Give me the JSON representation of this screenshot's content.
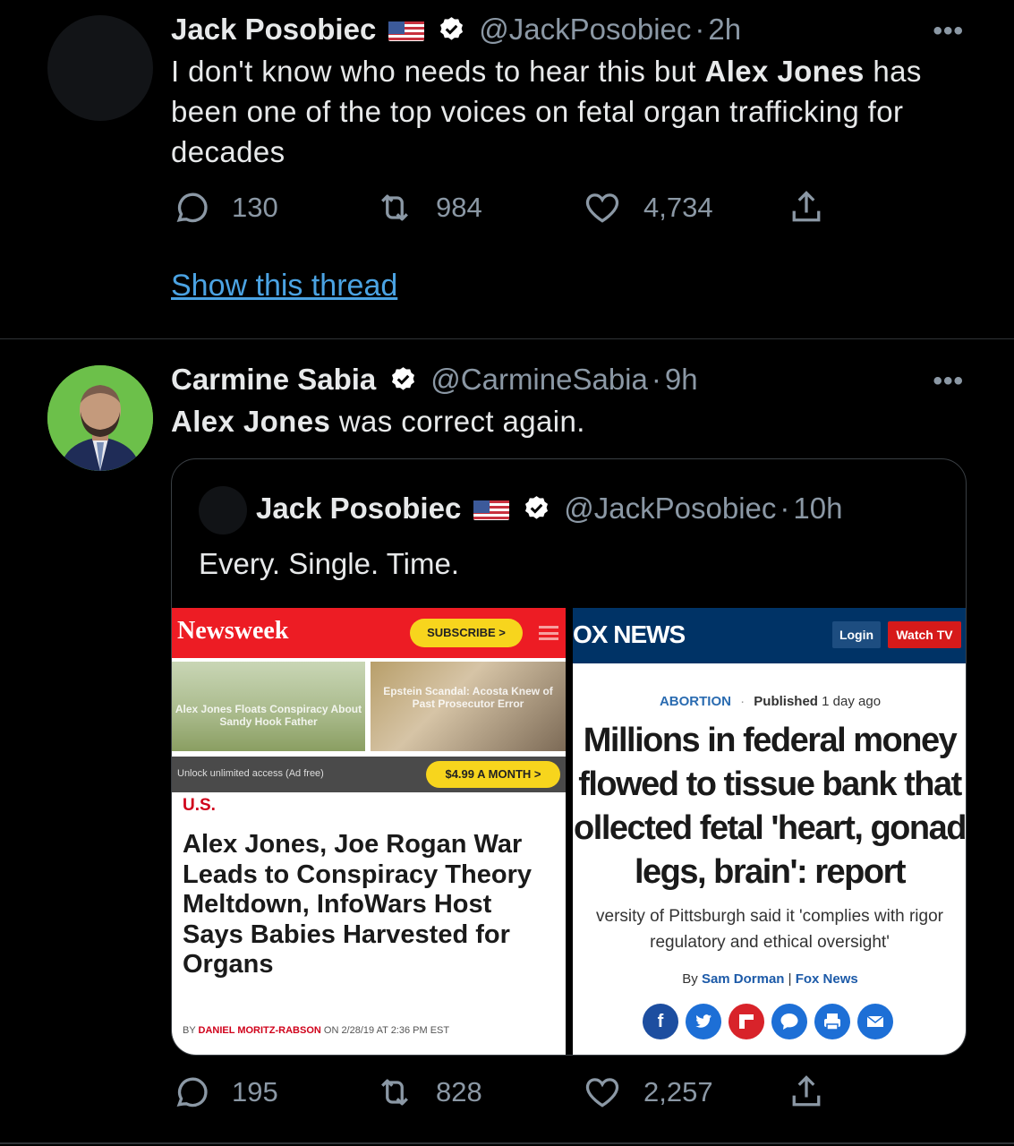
{
  "tweets": [
    {
      "name": "Jack Posobiec",
      "handle": "@JackPosobiec",
      "time_sep": "·",
      "time": "2h",
      "more": "•••",
      "text_pre": "I don't know who needs to hear this but ",
      "text_bold": "Alex Jones",
      "text_post": " has been one of the top voices on fetal organ trafficking for decades",
      "replies": "130",
      "retweets": "984",
      "likes": "4,734",
      "thread_link": "Show this thread"
    },
    {
      "name": "Carmine Sabia",
      "handle": "@CarmineSabia",
      "time_sep": "·",
      "time": "9h",
      "more": "•••",
      "text_bold": "Alex Jones",
      "text_post": " was correct again.",
      "replies": "195",
      "retweets": "828",
      "likes": "2,257",
      "quote": {
        "name": "Jack Posobiec",
        "handle": "@JackPosobiec",
        "time_sep": "·",
        "time": "10h",
        "text": "Every. Single. Time.",
        "newsweek": {
          "logo": "Newsweek",
          "subscribe": "SUBSCRIBE >",
          "thumb1_caption": "Alex Jones Floats Conspiracy About Sandy Hook Father",
          "thumb2_caption": "Epstein Scandal: Acosta Knew of Past Prosecutor Error",
          "unlock": "Unlock unlimited access (Ad free)",
          "price": "$4.99 A MONTH >",
          "section": "U.S.",
          "headline": "Alex Jones, Joe Rogan War Leads to Conspiracy Theory Meltdown, InfoWars Host Says Babies Harvested for Organs",
          "byline_pre": "BY ",
          "byline_author": "DANIEL MORITZ-RABSON",
          "byline_post": " ON 2/28/19 AT 2:36 PM EST"
        },
        "fox": {
          "logo": "OX NEWS",
          "login": "Login",
          "watch": "Watch TV",
          "section": "ABORTION",
          "dot": "·",
          "published_label": "Published",
          "published_value": "1 day ago",
          "headline_1": "Millions in federal money",
          "headline_2": "flowed to tissue bank that",
          "headline_3": "ollected fetal 'heart, gonad",
          "headline_4": "legs, brain': report",
          "sub_1": "versity of Pittsburgh said it 'complies with rigor",
          "sub_2": "regulatory and ethical oversight'",
          "by_label": "By ",
          "by_author": "Sam Dorman",
          "by_sep": " | ",
          "by_outlet": "Fox News"
        }
      }
    }
  ],
  "colors": {
    "background": "#000000",
    "text": "#e7e9ea",
    "muted": "#8b98a5",
    "link": "#4ba3e3"
  }
}
